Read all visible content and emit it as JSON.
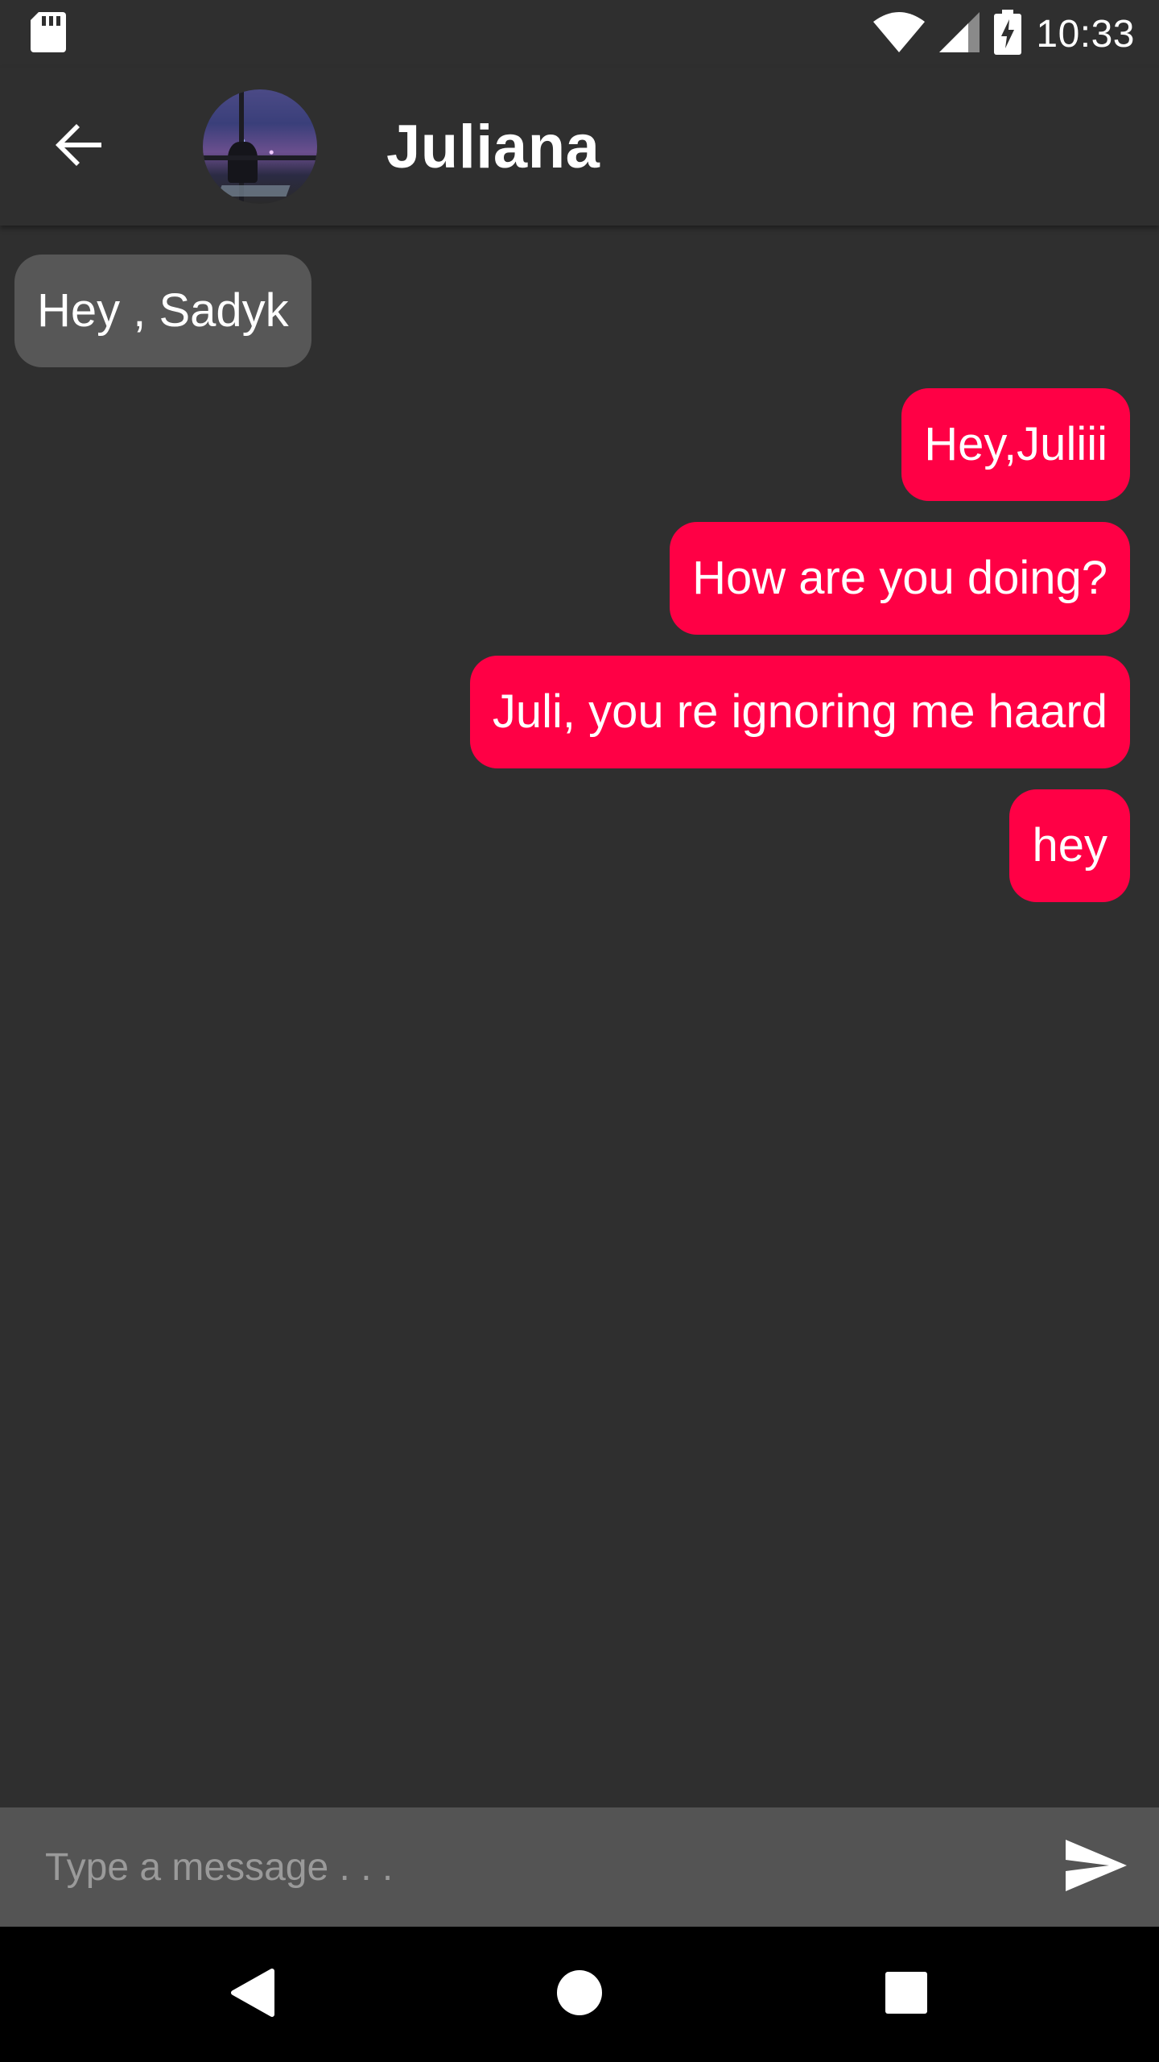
{
  "status_bar": {
    "time": "10:33",
    "icons": [
      "sd-card-icon",
      "wifi-icon",
      "cellular-signal-icon",
      "battery-charging-icon"
    ]
  },
  "header": {
    "contact_name": "Juliana",
    "back_icon": "arrow-back-icon",
    "avatar": "contact-avatar"
  },
  "messages": [
    {
      "direction": "incoming",
      "text": "Hey , Sadyk"
    },
    {
      "direction": "outgoing",
      "text": "Hey,Juliii"
    },
    {
      "direction": "outgoing",
      "text": "How are you doing?"
    },
    {
      "direction": "outgoing",
      "text": "Juli, you re ignoring me haard"
    },
    {
      "direction": "outgoing",
      "text": "hey"
    }
  ],
  "composer": {
    "placeholder": "Type a message . . .",
    "value": "",
    "send_icon": "send-icon"
  },
  "nav_bar": {
    "icons": [
      "nav-back-icon",
      "nav-home-icon",
      "nav-recents-icon"
    ]
  },
  "colors": {
    "background": "#2f2f2f",
    "incoming_bubble": "#575757",
    "outgoing_bubble": "#ff0045",
    "composer": "#545454",
    "nav_bar": "#000000",
    "text": "#ffffff"
  }
}
